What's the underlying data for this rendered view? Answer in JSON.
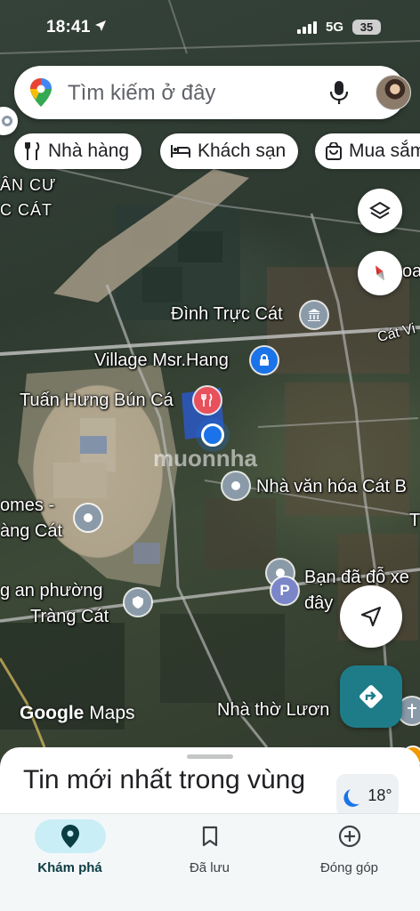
{
  "status_bar": {
    "time": "18:41",
    "network": "5G",
    "battery": "35"
  },
  "search": {
    "placeholder": "Tìm kiếm ở đây"
  },
  "chips": [
    {
      "label": "Nhà hàng",
      "icon": "restaurant-icon"
    },
    {
      "label": "Khách sạn",
      "icon": "hotel-icon"
    },
    {
      "label": "Mua sắm",
      "icon": "shopping-bag-icon"
    }
  ],
  "map": {
    "labels": {
      "area_top_1": "ÂN CƯ",
      "area_top_2": "C CÁT",
      "dinh": "Đình Trực Cát",
      "village": "Village Msr.Hang",
      "restaurant": "Tuấn Hưng Bún Cá",
      "road": "Cát Vi",
      "oa": "oa",
      "nha_van_hoa": "Nhà văn hóa Cát B",
      "homes_1": "omes -",
      "homes_2": "àng Cát",
      "cong_an_1": "g an phường",
      "cong_an_2": "Tràng Cát",
      "parking_1": "Bạn đã đỗ xe",
      "parking_2": "đây",
      "church": "Nhà thờ Lươn",
      "t_edge": "T",
      "watermark": "muonnha"
    },
    "attribution": {
      "google": "Google",
      "maps": "Maps"
    },
    "colors": {
      "accent": "#1a73e8",
      "direction_button": "#1e7c89",
      "restaurant_pin": "#e8505b",
      "place_pin": "#8a9aa8"
    }
  },
  "bottom_sheet": {
    "title": "Tin mới nhất trong vùng",
    "weather": "18°"
  },
  "nav": [
    {
      "label": "Khám phá",
      "icon": "explore-pin-icon",
      "active": true
    },
    {
      "label": "Đã lưu",
      "icon": "bookmark-icon",
      "active": false
    },
    {
      "label": "Đóng góp",
      "icon": "add-circle-icon",
      "active": false
    }
  ]
}
